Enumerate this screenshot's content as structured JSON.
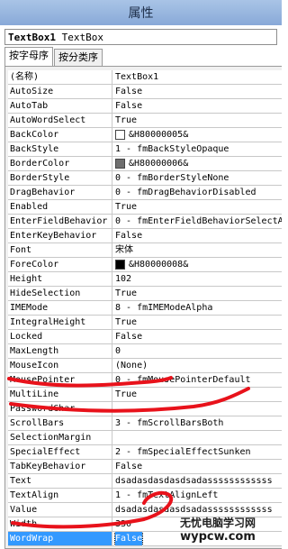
{
  "window": {
    "title": "属性"
  },
  "object_selector": {
    "name": "TextBox1",
    "type": "TextBox"
  },
  "tabs": [
    {
      "label": "按字母序"
    },
    {
      "label": "按分类序"
    }
  ],
  "properties": [
    {
      "name": "(名称)",
      "value": "TextBox1"
    },
    {
      "name": "AutoSize",
      "value": "False"
    },
    {
      "name": "AutoTab",
      "value": "False"
    },
    {
      "name": "AutoWordSelect",
      "value": "True"
    },
    {
      "name": "BackColor",
      "value": "&H80000005&",
      "swatch": "#ffffff"
    },
    {
      "name": "BackStyle",
      "value": "1 - fmBackStyleOpaque"
    },
    {
      "name": "BorderColor",
      "value": "&H80000006&",
      "swatch": "#6e6e6e"
    },
    {
      "name": "BorderStyle",
      "value": "0 - fmBorderStyleNone"
    },
    {
      "name": "DragBehavior",
      "value": "0 - fmDragBehaviorDisabled"
    },
    {
      "name": "Enabled",
      "value": "True"
    },
    {
      "name": "EnterFieldBehavior",
      "value": "0 - fmEnterFieldBehaviorSelectA"
    },
    {
      "name": "EnterKeyBehavior",
      "value": "False"
    },
    {
      "name": "Font",
      "value": "宋体"
    },
    {
      "name": "ForeColor",
      "value": "&H80000008&",
      "swatch": "#000000"
    },
    {
      "name": "Height",
      "value": "102"
    },
    {
      "name": "HideSelection",
      "value": "True"
    },
    {
      "name": "IMEMode",
      "value": "8 - fmIMEModeAlpha"
    },
    {
      "name": "IntegralHeight",
      "value": "True"
    },
    {
      "name": "Locked",
      "value": "False"
    },
    {
      "name": "MaxLength",
      "value": "0"
    },
    {
      "name": "MouseIcon",
      "value": "(None)"
    },
    {
      "name": "MousePointer",
      "value": "0 - fmMousePointerDefault"
    },
    {
      "name": "MultiLine",
      "value": "True"
    },
    {
      "name": "PasswordChar",
      "value": ""
    },
    {
      "name": "ScrollBars",
      "value": "3 - fmScrollBarsBoth"
    },
    {
      "name": "SelectionMargin",
      "value": ""
    },
    {
      "name": "SpecialEffect",
      "value": "2 - fmSpecialEffectSunken"
    },
    {
      "name": "TabKeyBehavior",
      "value": "False"
    },
    {
      "name": "Text",
      "value": "dsadasdasdasdsadassssssssssss"
    },
    {
      "name": "TextAlign",
      "value": "1 - fmTextAlignLeft"
    },
    {
      "name": "Value",
      "value": "dsadasdasdasdsadassssssssssss"
    },
    {
      "name": "Width",
      "value": "330"
    },
    {
      "name": "WordWrap",
      "value": "False",
      "selected": true
    }
  ],
  "annotation_color": "#e8121b",
  "selection_color": "#3399ff",
  "watermark": {
    "line1": "无忧电脑学习网",
    "line2": "wypcw.com"
  }
}
